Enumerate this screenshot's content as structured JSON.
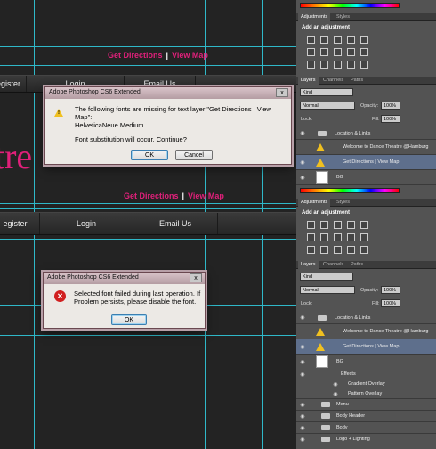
{
  "canvas": {
    "top_links": {
      "directions": "Get Directions",
      "sep": "|",
      "map": "View Map"
    },
    "nav_top": {
      "register": "egister",
      "login": "Login",
      "email": "Email Us"
    },
    "big_text": "tre",
    "links2": {
      "directions": "Get Directions",
      "sep": "|",
      "map": "View Map"
    },
    "nav2": {
      "register": "egister",
      "login": "Login",
      "email": "Email Us"
    }
  },
  "dialog1": {
    "title": "Adobe Photoshop CS6 Extended",
    "message": "The following fonts are missing for text layer \"Get Directions  |  View Map\":",
    "font": "HelveticaNeue Medium",
    "question": "Font substitution will occur. Continue?",
    "ok": "OK",
    "cancel": "Cancel",
    "close": "x"
  },
  "dialog2": {
    "title": "Adobe Photoshop CS6 Extended",
    "message": "Selected font failed during last operation. If Problem persists, please disable the font.",
    "ok": "OK",
    "close": "x"
  },
  "panel_top": {
    "tabs": [
      "Adjustments",
      "Styles"
    ],
    "add_adjustment": "Add an adjustment",
    "layer_tabs": [
      "Layers",
      "Channels",
      "Paths"
    ],
    "kind": "Kind",
    "blend": "Normal",
    "opacity_label": "Opacity:",
    "opacity": "100%",
    "lock_label": "Lock:",
    "fill_label": "Fill:",
    "fill": "100%",
    "layers": [
      {
        "name": "Location & Links",
        "type": "folder"
      },
      {
        "name": "Welcome to Dance Theatre @Hamburg",
        "type": "text"
      },
      {
        "name": "Get Directions  |  View Map",
        "type": "text"
      },
      {
        "name": "BG",
        "type": "image"
      }
    ]
  },
  "panel_bottom": {
    "tabs": [
      "Adjustments",
      "Styles"
    ],
    "add_adjustment": "Add an adjustment",
    "layer_tabs": [
      "Layers",
      "Channels",
      "Paths"
    ],
    "kind": "Kind",
    "blend": "Normal",
    "opacity_label": "Opacity:",
    "opacity": "100%",
    "lock_label": "Lock:",
    "fill_label": "Fill:",
    "fill": "100%",
    "layers": [
      {
        "name": "Location & Links",
        "type": "folder"
      },
      {
        "name": "Welcome to Dance Theatre @Hamburg",
        "type": "text"
      },
      {
        "name": "Get Directions  |  View Map",
        "type": "text"
      },
      {
        "name": "BG",
        "type": "image"
      },
      {
        "name": "Effects",
        "type": "effect"
      },
      {
        "name": "Gradient Overlay",
        "type": "effect"
      },
      {
        "name": "Pattern Overlay",
        "type": "effect"
      },
      {
        "name": "Menu",
        "type": "folder"
      },
      {
        "name": "Body Header",
        "type": "folder"
      },
      {
        "name": "Body",
        "type": "folder"
      },
      {
        "name": "Logo + Lighting",
        "type": "folder"
      }
    ]
  },
  "colors": {
    "link": "#e0207a",
    "guide": "#2fb8c8",
    "selected_layer": "#5e6f8c"
  }
}
